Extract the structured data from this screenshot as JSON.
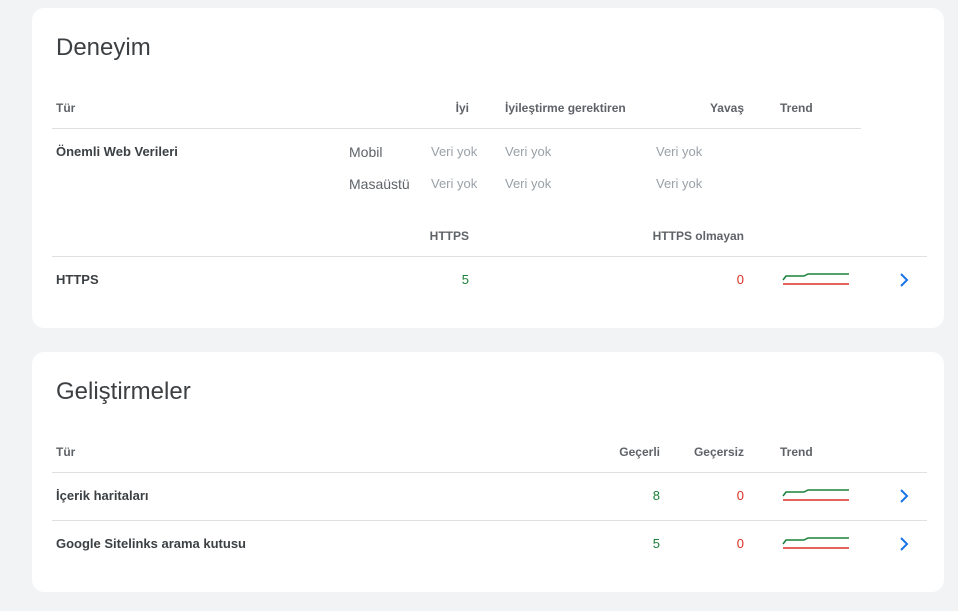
{
  "experience": {
    "title": "Deneyim",
    "headers": {
      "type": "Tür",
      "good": "İyi",
      "needs_improvement": "İyileştirme gerektiren",
      "slow": "Yavaş",
      "trend": "Trend"
    },
    "cwv": {
      "label": "Önemli Web Verileri",
      "rows": [
        {
          "device": "Mobil",
          "good": "Veri yok",
          "needs_improvement": "Veri yok",
          "slow": "Veri yok"
        },
        {
          "device": "Masaüstü",
          "good": "Veri yok",
          "needs_improvement": "Veri yok",
          "slow": "Veri yok"
        }
      ]
    },
    "https": {
      "header_https": "HTTPS",
      "header_non_https": "HTTPS olmayan",
      "label": "HTTPS",
      "https_count": "5",
      "non_https_count": "0"
    }
  },
  "enhancements": {
    "title": "Geliştirmeler",
    "headers": {
      "type": "Tür",
      "valid": "Geçerli",
      "invalid": "Geçersiz",
      "trend": "Trend"
    },
    "rows": [
      {
        "label": "İçerik haritaları",
        "valid": "8",
        "invalid": "0"
      },
      {
        "label": "Google Sitelinks arama kutusu",
        "valid": "5",
        "invalid": "0"
      }
    ]
  },
  "colors": {
    "good": "#188038",
    "bad": "#d93025",
    "link": "#1a73e8"
  },
  "icons": {
    "trend": "sparkline-icon",
    "open": "chevron-right-icon"
  }
}
